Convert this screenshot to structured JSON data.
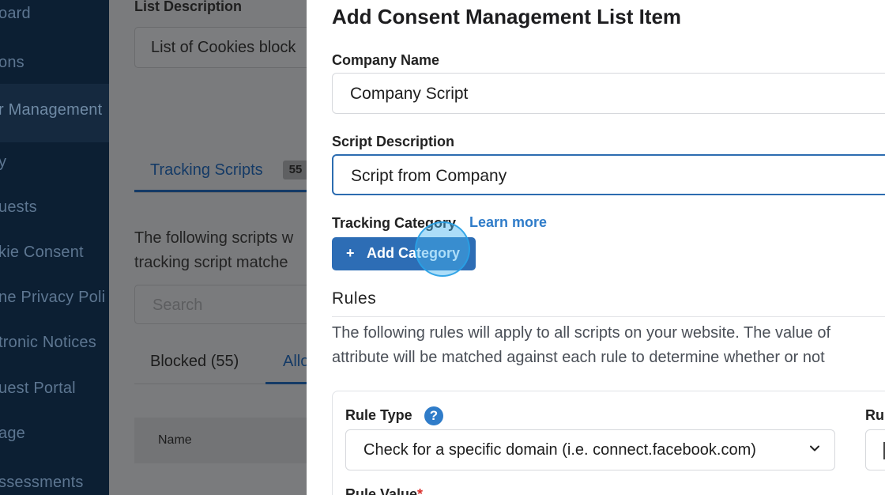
{
  "sidebar": {
    "items": [
      {
        "label": "oard"
      },
      {
        "label": "ons"
      },
      {
        "label": "r Management"
      },
      {
        "label": "y"
      },
      {
        "label": "uests"
      },
      {
        "label": "kie Consent"
      },
      {
        "label": "ne Privacy Poli"
      },
      {
        "label": "tronic Notices"
      },
      {
        "label": "uest Portal"
      },
      {
        "label": "age"
      },
      {
        "label": "ssessments"
      }
    ]
  },
  "background": {
    "list_description_label": "List Description",
    "list_description_value": "List of Cookies block",
    "tab_label": "Tracking Scripts",
    "tab_count": "55",
    "desc_line1": "The following scripts w",
    "desc_line2": "tracking script matche",
    "search_placeholder": "Search",
    "subtab_blocked": "Blocked (55)",
    "subtab_allowed": "Allo",
    "table_header": "Name"
  },
  "modal": {
    "title": "Add Consent Management List Item",
    "company_name_label": "Company Name",
    "company_name_value": "Company Script",
    "script_description_label": "Script Description",
    "script_description_value": "Script from Company",
    "tracking_category_label": "Tracking Category",
    "learn_more": "Learn more",
    "add_category_plus": "+",
    "add_category_label": "Add Category",
    "rules_heading": "Rules",
    "rules_text_line1": "The following rules will apply to all scripts on your website. The value of",
    "rules_text_line2": "attribute will be matched against each rule to determine whether or not",
    "rule_type_label": "Rule Type",
    "rule_type_help": "?",
    "rule_type_value": "Check for a specific domain (i.e. connect.facebook.com)",
    "second_column_label": "Rul",
    "rule_value_label": "Rule Value",
    "required_mark": "*"
  },
  "colors": {
    "sidebar_bg": "#0c1f33",
    "primary": "#2d6db5",
    "link": "#2f7cc9",
    "focus_border": "#2c6cb0"
  }
}
